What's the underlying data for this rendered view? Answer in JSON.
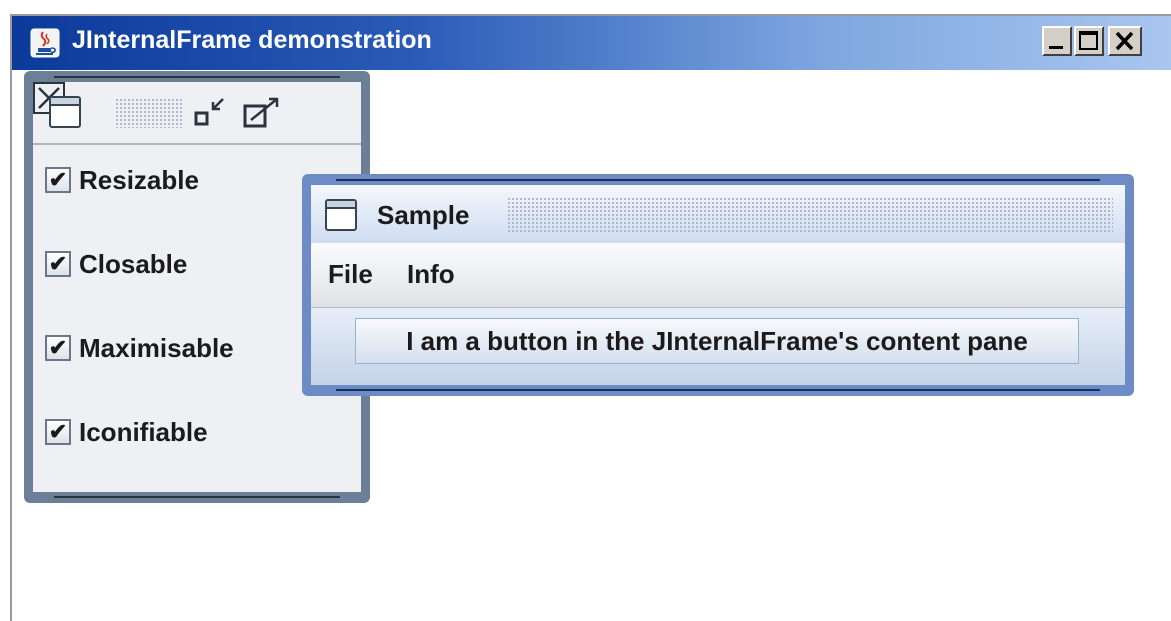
{
  "window": {
    "title": "JInternalFrame demonstration",
    "titlebar_gradient": [
      "#0b3a9a",
      "#a9c6ee"
    ],
    "icons": [
      "java-cup-icon",
      "minimize-icon",
      "maximize-icon",
      "close-icon"
    ]
  },
  "control_frame": {
    "icons": [
      "frame-icon",
      "iconify-icon",
      "maximize-icon",
      "close-icon"
    ],
    "options": [
      {
        "label": "Resizable",
        "checked": true
      },
      {
        "label": "Closable",
        "checked": true
      },
      {
        "label": "Maximisable",
        "checked": true
      },
      {
        "label": "Iconifiable",
        "checked": true
      }
    ],
    "check_mark": "✔"
  },
  "sample_frame": {
    "title": "Sample",
    "menus": [
      "File",
      "Info"
    ],
    "button_label": "I am a button in the JInternalFrame's content pane",
    "border_color": "#6d8cc6"
  }
}
